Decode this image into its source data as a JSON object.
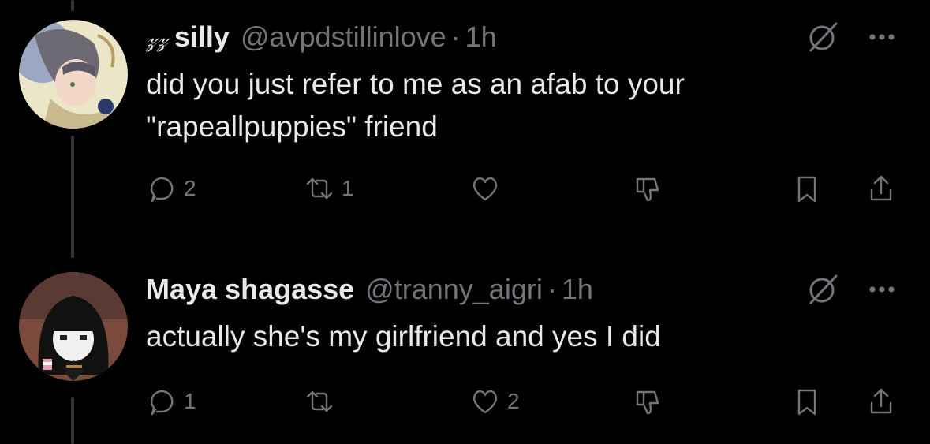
{
  "colors": {
    "background": "#000000",
    "text": "#e7e9ea",
    "muted": "#71767b",
    "thread_line": "#333639"
  },
  "tweets": [
    {
      "name_prefix": "𝓏𝓏",
      "display_name": "silly",
      "handle": "@avpdstillinlove",
      "separator": "·",
      "time": "1h",
      "text_line1": "did you just refer to me as an afab to your",
      "text_line2": "\"rapeallpuppies\" friend",
      "replies": "2",
      "reposts": "1",
      "likes": ""
    },
    {
      "display_name": "Maya shagasse",
      "handle": "@tranny_aigri",
      "separator": "·",
      "time": "1h",
      "text_line1": "actually she's my girlfriend and yes I did",
      "replies": "1",
      "reposts": "",
      "likes": "2"
    }
  ],
  "icons": [
    "reply-icon",
    "repost-icon",
    "like-icon",
    "dislike-icon",
    "bookmark-icon",
    "share-icon",
    "grok-icon",
    "more-icon"
  ]
}
